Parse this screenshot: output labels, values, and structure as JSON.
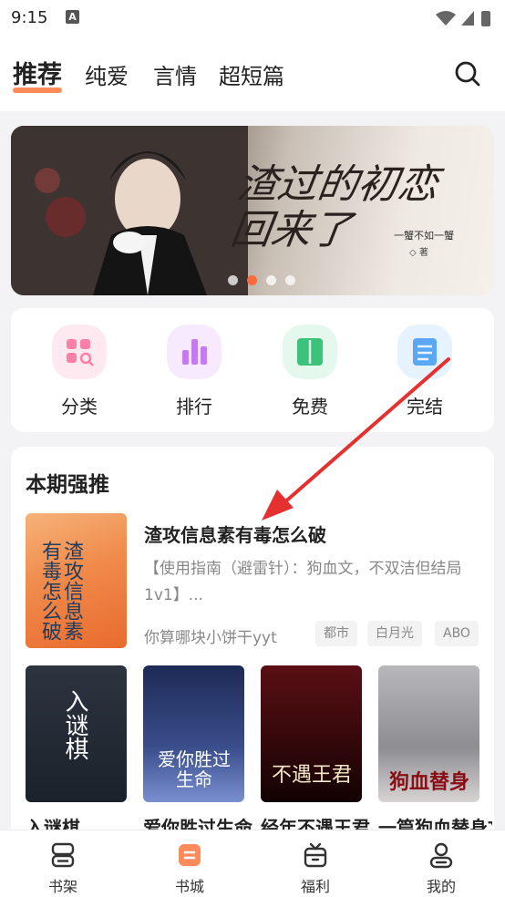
{
  "status": {
    "time": "9:15",
    "notif": "A"
  },
  "nav": {
    "tabs": [
      "推荐",
      "纯爱",
      "言情",
      "超短篇"
    ],
    "active_index": 0,
    "accent": "#ff8a5c"
  },
  "banner": {
    "title": "渣过的初恋回来了",
    "subtitle": "一蟹不如一蟹",
    "author": "◇ 著",
    "dots": 4,
    "active_dot": 1
  },
  "categories": [
    {
      "label": "分类",
      "icon": "grid-search-icon",
      "color": "#ff7fa6"
    },
    {
      "label": "排行",
      "icon": "bar-chart-icon",
      "color": "#c57bf0"
    },
    {
      "label": "免费",
      "icon": "book-icon",
      "color": "#3cc27a"
    },
    {
      "label": "完结",
      "icon": "document-icon",
      "color": "#5aa8f5"
    }
  ],
  "recommend": {
    "heading": "本期强推",
    "featured": {
      "title": "渣攻信息素有毒怎么破",
      "cover_text": "渣攻信息素有毒怎么破",
      "description": "【使用指南（避雷针）：狗血文，不双洁但结局1v1】...",
      "author": "你算哪块小饼干yyt",
      "tags": [
        "都市",
        "白月光",
        "ABO"
      ]
    },
    "books": [
      {
        "title": "入谜棋",
        "cover_text": "入谜棋"
      },
      {
        "title": "爱你胜过生命",
        "cover_text": "爱你胜过生命"
      },
      {
        "title": "经年不遇王君",
        "cover_text": "不遇王君"
      },
      {
        "title": "一篇狗血替身文",
        "cover_text": "狗血替身"
      }
    ]
  },
  "bottom_nav": [
    {
      "label": "书架",
      "icon": "bookshelf-icon"
    },
    {
      "label": "书城",
      "icon": "bookstore-icon",
      "active": true
    },
    {
      "label": "福利",
      "icon": "gift-icon"
    },
    {
      "label": "我的",
      "icon": "profile-icon"
    }
  ]
}
